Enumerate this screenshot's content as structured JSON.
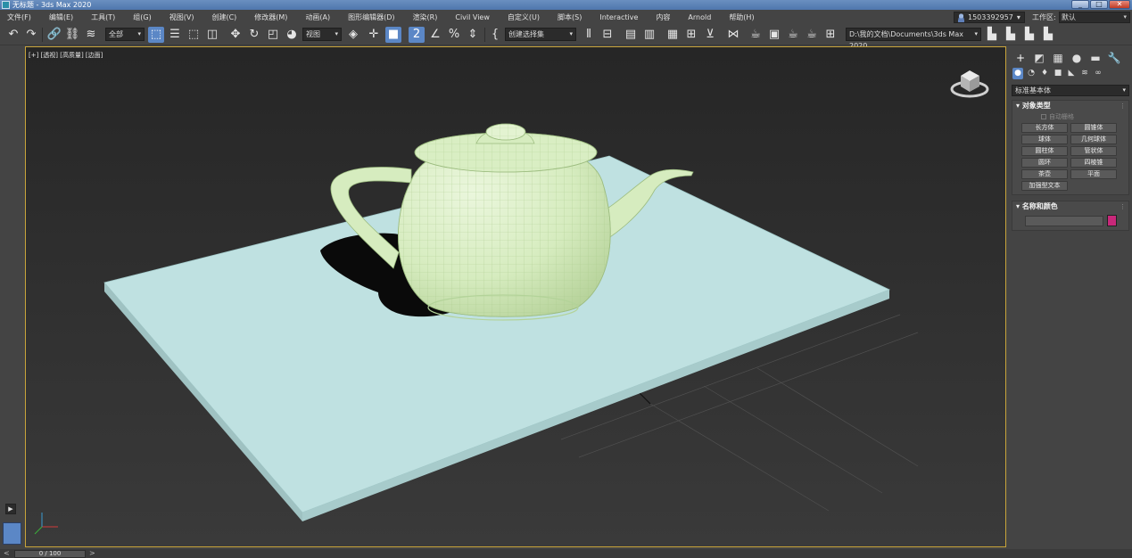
{
  "window": {
    "title": "无标题 - 3ds Max 2020",
    "buttons": [
      "_",
      "□",
      "✕"
    ]
  },
  "menubar": {
    "items": [
      "文件(F)",
      "编辑(E)",
      "工具(T)",
      "组(G)",
      "视图(V)",
      "创建(C)",
      "修改器(M)",
      "动画(A)",
      "图形编辑器(D)",
      "渲染(R)",
      "Civil View",
      "自定义(U)",
      "脚本(S)",
      "Interactive",
      "内容",
      "Arnold",
      "帮助(H)"
    ],
    "user": "1503392957",
    "workspace_label": "工作区:",
    "workspace_value": "默认"
  },
  "toolbar": {
    "selection_filter": "全部",
    "reference_coord": "视图",
    "named_selection": "创建选择集",
    "project_path": "D:\\我的文档\\Documents\\3ds Max 2020"
  },
  "viewport": {
    "label": "[+] [透视] [高质量] [边面]",
    "teapot_color": "#d6ecbf",
    "plane_color": "#bfe1e1",
    "background_top": "#262626",
    "background_bottom": "#3a3a3a",
    "border_color": "#c8a43a"
  },
  "timeline": {
    "frame": "0 / 100",
    "prev": "<",
    "next": ">"
  },
  "command_panel": {
    "tabs": [
      "create-icon",
      "modify-icon",
      "hierarchy-icon",
      "motion-icon",
      "display-icon",
      "utilities-icon"
    ],
    "category": "标准基本体",
    "object_type": {
      "header": "对象类型",
      "autogrid": "自动栅格",
      "buttons": [
        "长方体",
        "圆锥体",
        "球体",
        "几何球体",
        "圆柱体",
        "管状体",
        "圆环",
        "四棱锥",
        "茶壶",
        "平面",
        "加强型文本"
      ]
    },
    "name_color": {
      "header": "名称和颜色",
      "color": "#c8287a"
    }
  }
}
